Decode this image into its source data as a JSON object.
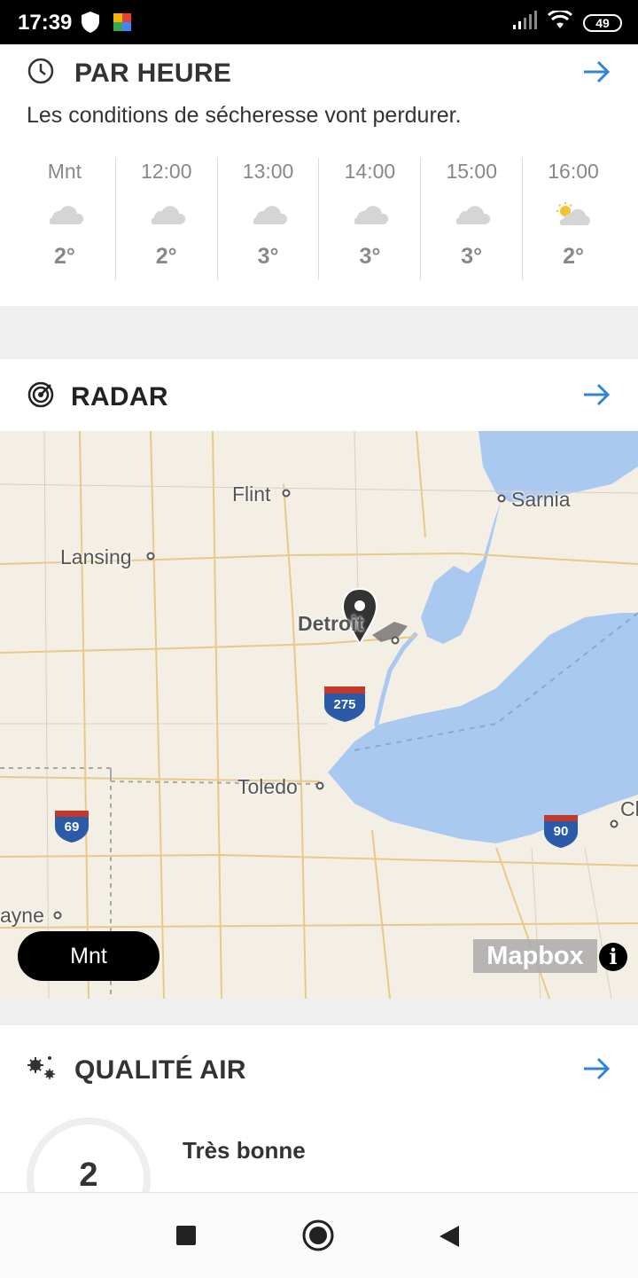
{
  "status_bar": {
    "time": "17:39",
    "battery": "49",
    "icons": [
      "shield-icon",
      "app-icon",
      "signal-icon",
      "wifi-icon",
      "battery-icon"
    ]
  },
  "hourly": {
    "title": "PAR HEURE",
    "subtitle": "Les conditions de sécheresse vont perdurer.",
    "hours": [
      {
        "time": "Mnt",
        "temp": "2°",
        "icon": "cloud-icon"
      },
      {
        "time": "12:00",
        "temp": "2°",
        "icon": "cloud-icon"
      },
      {
        "time": "13:00",
        "temp": "3°",
        "icon": "cloud-icon"
      },
      {
        "time": "14:00",
        "temp": "3°",
        "icon": "cloud-icon"
      },
      {
        "time": "15:00",
        "temp": "3°",
        "icon": "cloud-icon"
      },
      {
        "time": "16:00",
        "temp": "2°",
        "icon": "partly-sunny-icon"
      }
    ]
  },
  "radar": {
    "title": "RADAR",
    "now_label": "Mnt",
    "attribution": "Mapbox",
    "info": "i",
    "cities": [
      "Flint",
      "Sarnia",
      "Lansing",
      "Detroit",
      "Toledo",
      "ayne",
      "Cl"
    ],
    "highways": [
      "275",
      "69",
      "90"
    ]
  },
  "air_quality": {
    "title": "QUALITÉ AIR",
    "value": "2",
    "label": "Très bonne"
  },
  "colors": {
    "accent": "#2f86d8",
    "water": "#a9c9f0",
    "map_land": "#f4efe4"
  }
}
